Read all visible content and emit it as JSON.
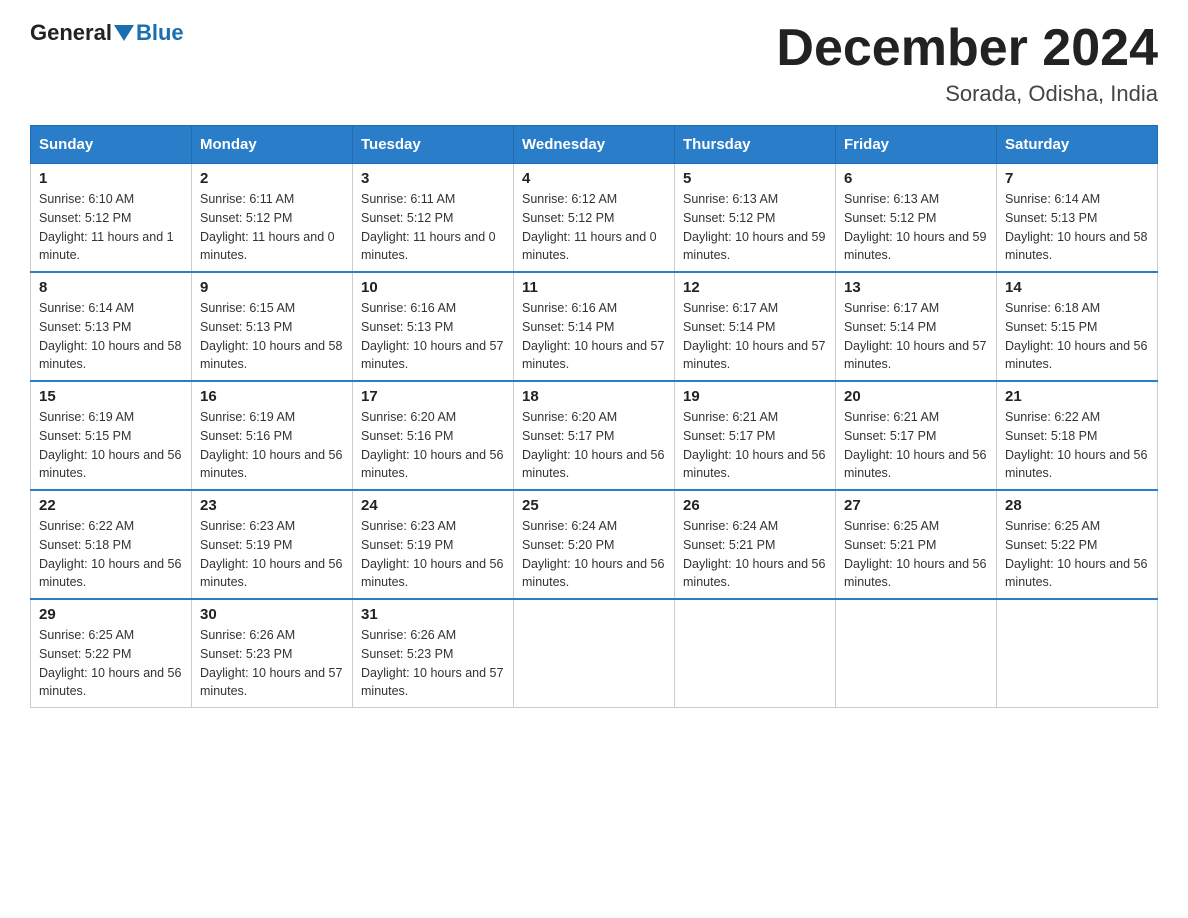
{
  "header": {
    "logo_general": "General",
    "logo_blue": "Blue",
    "month_title": "December 2024",
    "location": "Sorada, Odisha, India"
  },
  "days_of_week": [
    "Sunday",
    "Monday",
    "Tuesday",
    "Wednesday",
    "Thursday",
    "Friday",
    "Saturday"
  ],
  "weeks": [
    [
      {
        "day": "1",
        "sunrise": "6:10 AM",
        "sunset": "5:12 PM",
        "daylight": "11 hours and 1 minute."
      },
      {
        "day": "2",
        "sunrise": "6:11 AM",
        "sunset": "5:12 PM",
        "daylight": "11 hours and 0 minutes."
      },
      {
        "day": "3",
        "sunrise": "6:11 AM",
        "sunset": "5:12 PM",
        "daylight": "11 hours and 0 minutes."
      },
      {
        "day": "4",
        "sunrise": "6:12 AM",
        "sunset": "5:12 PM",
        "daylight": "11 hours and 0 minutes."
      },
      {
        "day": "5",
        "sunrise": "6:13 AM",
        "sunset": "5:12 PM",
        "daylight": "10 hours and 59 minutes."
      },
      {
        "day": "6",
        "sunrise": "6:13 AM",
        "sunset": "5:12 PM",
        "daylight": "10 hours and 59 minutes."
      },
      {
        "day": "7",
        "sunrise": "6:14 AM",
        "sunset": "5:13 PM",
        "daylight": "10 hours and 58 minutes."
      }
    ],
    [
      {
        "day": "8",
        "sunrise": "6:14 AM",
        "sunset": "5:13 PM",
        "daylight": "10 hours and 58 minutes."
      },
      {
        "day": "9",
        "sunrise": "6:15 AM",
        "sunset": "5:13 PM",
        "daylight": "10 hours and 58 minutes."
      },
      {
        "day": "10",
        "sunrise": "6:16 AM",
        "sunset": "5:13 PM",
        "daylight": "10 hours and 57 minutes."
      },
      {
        "day": "11",
        "sunrise": "6:16 AM",
        "sunset": "5:14 PM",
        "daylight": "10 hours and 57 minutes."
      },
      {
        "day": "12",
        "sunrise": "6:17 AM",
        "sunset": "5:14 PM",
        "daylight": "10 hours and 57 minutes."
      },
      {
        "day": "13",
        "sunrise": "6:17 AM",
        "sunset": "5:14 PM",
        "daylight": "10 hours and 57 minutes."
      },
      {
        "day": "14",
        "sunrise": "6:18 AM",
        "sunset": "5:15 PM",
        "daylight": "10 hours and 56 minutes."
      }
    ],
    [
      {
        "day": "15",
        "sunrise": "6:19 AM",
        "sunset": "5:15 PM",
        "daylight": "10 hours and 56 minutes."
      },
      {
        "day": "16",
        "sunrise": "6:19 AM",
        "sunset": "5:16 PM",
        "daylight": "10 hours and 56 minutes."
      },
      {
        "day": "17",
        "sunrise": "6:20 AM",
        "sunset": "5:16 PM",
        "daylight": "10 hours and 56 minutes."
      },
      {
        "day": "18",
        "sunrise": "6:20 AM",
        "sunset": "5:17 PM",
        "daylight": "10 hours and 56 minutes."
      },
      {
        "day": "19",
        "sunrise": "6:21 AM",
        "sunset": "5:17 PM",
        "daylight": "10 hours and 56 minutes."
      },
      {
        "day": "20",
        "sunrise": "6:21 AM",
        "sunset": "5:17 PM",
        "daylight": "10 hours and 56 minutes."
      },
      {
        "day": "21",
        "sunrise": "6:22 AM",
        "sunset": "5:18 PM",
        "daylight": "10 hours and 56 minutes."
      }
    ],
    [
      {
        "day": "22",
        "sunrise": "6:22 AM",
        "sunset": "5:18 PM",
        "daylight": "10 hours and 56 minutes."
      },
      {
        "day": "23",
        "sunrise": "6:23 AM",
        "sunset": "5:19 PM",
        "daylight": "10 hours and 56 minutes."
      },
      {
        "day": "24",
        "sunrise": "6:23 AM",
        "sunset": "5:19 PM",
        "daylight": "10 hours and 56 minutes."
      },
      {
        "day": "25",
        "sunrise": "6:24 AM",
        "sunset": "5:20 PM",
        "daylight": "10 hours and 56 minutes."
      },
      {
        "day": "26",
        "sunrise": "6:24 AM",
        "sunset": "5:21 PM",
        "daylight": "10 hours and 56 minutes."
      },
      {
        "day": "27",
        "sunrise": "6:25 AM",
        "sunset": "5:21 PM",
        "daylight": "10 hours and 56 minutes."
      },
      {
        "day": "28",
        "sunrise": "6:25 AM",
        "sunset": "5:22 PM",
        "daylight": "10 hours and 56 minutes."
      }
    ],
    [
      {
        "day": "29",
        "sunrise": "6:25 AM",
        "sunset": "5:22 PM",
        "daylight": "10 hours and 56 minutes."
      },
      {
        "day": "30",
        "sunrise": "6:26 AM",
        "sunset": "5:23 PM",
        "daylight": "10 hours and 57 minutes."
      },
      {
        "day": "31",
        "sunrise": "6:26 AM",
        "sunset": "5:23 PM",
        "daylight": "10 hours and 57 minutes."
      },
      null,
      null,
      null,
      null
    ]
  ]
}
